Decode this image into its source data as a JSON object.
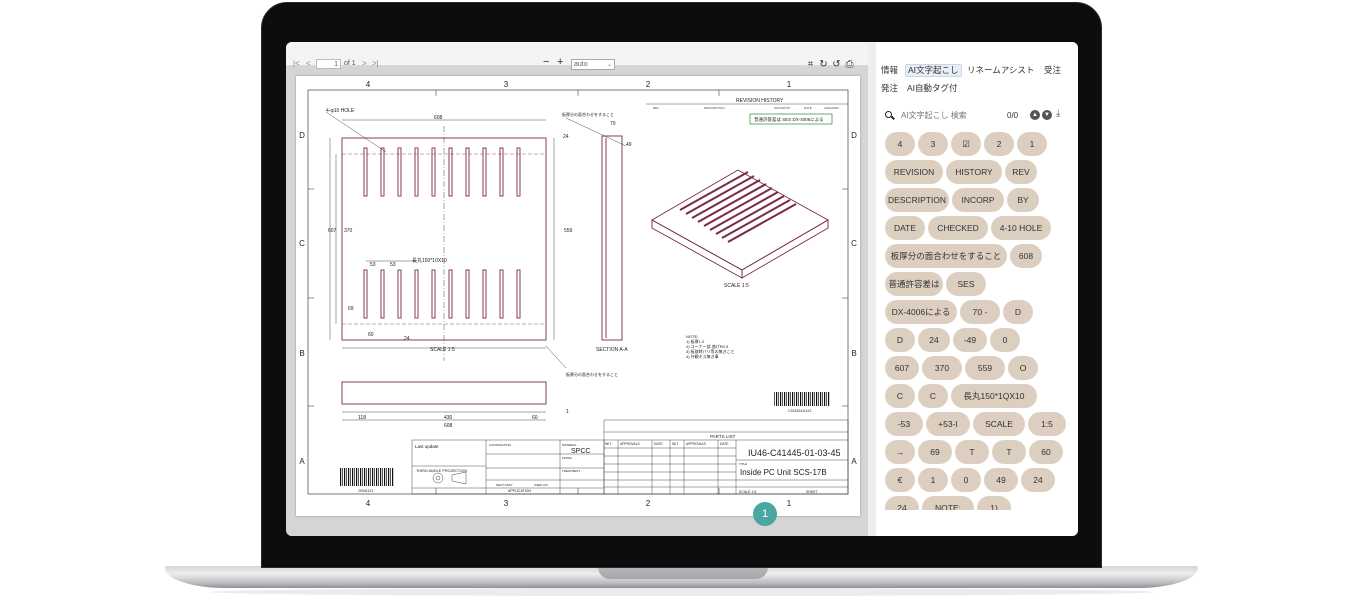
{
  "viewer": {
    "toolbar": {
      "first_page": "|<",
      "prev_page": "<",
      "page_number": "1",
      "page_of": "of 1",
      "next_page": ">",
      "last_page": ">|",
      "zoom_out": "−",
      "zoom_in": "+",
      "zoom_value": "auto",
      "crop_icon": "crop-icon",
      "rotate_cw_icon": "rotate-right-icon",
      "rotate_ccw_icon": "rotate-left-icon",
      "print_icon": "print-icon"
    }
  },
  "drawing": {
    "zones_top": [
      "4",
      "3",
      "2",
      "1"
    ],
    "zones_bottom": [
      "4",
      "3",
      "2",
      "1"
    ],
    "rows_left": [
      "D",
      "C",
      "B",
      "A"
    ],
    "rows_right": [
      "D",
      "C",
      "B",
      "A"
    ],
    "revision_title": "REVISION HISTORY",
    "revision_cols": [
      "REV",
      "DESCRIPTION",
      "INCORP BY",
      "DATE",
      "CHECKED"
    ],
    "general_tolerance": "普通許容差は SES DX-4006による",
    "hole_note": "4-φ10 HOLE",
    "dim_608": "608",
    "dim_70": "70",
    "dim_49": "49",
    "dim_24": "24",
    "dim_607": "607",
    "dim_370": "370",
    "dim_559": "559",
    "dim_53a": "53",
    "dim_53b": "53",
    "slot_label": "長丸150*10X10",
    "dim_69": "69",
    "dim_60": "60",
    "dim_24b": "24",
    "dim_118": "118",
    "dim_430": "430",
    "dim_60b": "60",
    "dim_608b": "608",
    "dim_1": "1",
    "note_top": "板厚分の面合わせをすること",
    "note_bottom": "板厚分の面合わせをすること",
    "scale_label": "SCALE 1:5",
    "scale_label2": "SCALE 1:5",
    "section_label": "SECTION A-A",
    "notes_title": "NOTE:",
    "notes": [
      "1) 板厚1.0",
      "2) コーナー部 曲げR0.5",
      "3) 板取時バリ等の無きこと",
      "4) 外観キズ無き事"
    ],
    "barcode_top_text": "C32432411122",
    "barcode_bottom_text": "20041121",
    "last_update": "Last update",
    "contracting": "CONTRACTING",
    "material_label": "MATERIAL",
    "material": "SPCC",
    "finish_label": "FINISH",
    "treatment_label": "TREATMENT",
    "next_assy": "NEXT ASSY",
    "used_on": "USED ON",
    "application": "APPLICATION",
    "third_angle": "THIRD ANGLE PROJECTION",
    "parts_list": "PARTS LIST",
    "approvals_cols": [
      "INIT",
      "APPROVALS",
      "DATE",
      "INIT",
      "APPROVALS",
      "DATE"
    ],
    "drawing_no": "IU46-C41445-01-03-45",
    "title_label": "TITLE",
    "title": "Inside PC Unit SCS-17B",
    "scale_small": "SCALE 1:5",
    "sheet_label": "SHEET"
  },
  "panel": {
    "tabs": [
      "情報",
      "AI文字起こし",
      "リネームアシスト",
      "受注",
      "発注",
      "AI自動タグ付"
    ],
    "active_tab": "AI文字起こし",
    "search_placeholder": "AI文字起こし 検索",
    "search_count": "0/0",
    "chips": [
      [
        "4",
        "3",
        "☑",
        "2",
        "1"
      ],
      [
        "REVISION",
        "HISTORY",
        "REV"
      ],
      [
        "DESCRIPTION",
        "INCORP",
        "BY"
      ],
      [
        "DATE",
        "CHECKED",
        "4-10 HOLE"
      ],
      [
        "板厚分の面合わせをすること",
        "608"
      ],
      [
        "普通許容差は",
        "SES"
      ],
      [
        "DX-4006による",
        "70 -",
        "D"
      ],
      [
        "D",
        "24",
        "-49",
        "0"
      ],
      [
        "607",
        "370",
        "559",
        "O"
      ],
      [
        "C",
        "C",
        "長丸150*1QX10"
      ],
      [
        "-53",
        "+53-I",
        "SCALE",
        "1:5"
      ],
      [
        "→",
        "69",
        "T",
        "T",
        "60"
      ],
      [
        "€",
        "1",
        "0",
        "49",
        "24"
      ],
      [
        "24",
        "NOTE:",
        "1)"
      ]
    ],
    "fab_label": "1"
  },
  "colors": {
    "chip": "#ddcfc0",
    "fab": "#4aa6a1",
    "drawing_line": "#7a2a44"
  }
}
